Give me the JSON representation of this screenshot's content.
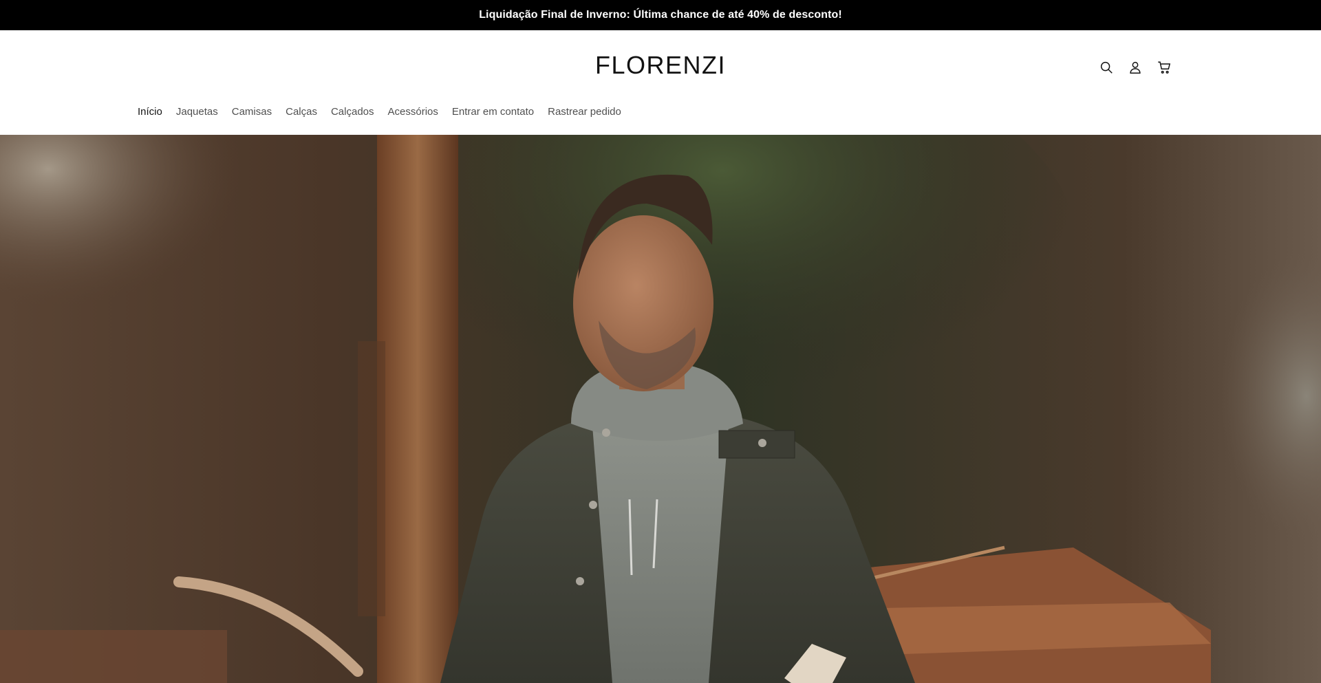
{
  "announcement": {
    "text": "Liquidação Final de Inverno: Última chance de até 40% de desconto!"
  },
  "header": {
    "logo": "FLORENZI",
    "icons": [
      "search-icon",
      "account-icon",
      "cart-icon"
    ]
  },
  "nav": {
    "items": [
      {
        "label": "Início",
        "active": true
      },
      {
        "label": "Jaquetas"
      },
      {
        "label": "Camisas"
      },
      {
        "label": "Calças"
      },
      {
        "label": "Calçados"
      },
      {
        "label": "Acessórios"
      },
      {
        "label": "Entrar em contato"
      },
      {
        "label": "Rastrear pedido"
      }
    ]
  },
  "colors": {
    "announcement_bg": "#000000",
    "text": "#121212",
    "background": "#ffffff"
  }
}
